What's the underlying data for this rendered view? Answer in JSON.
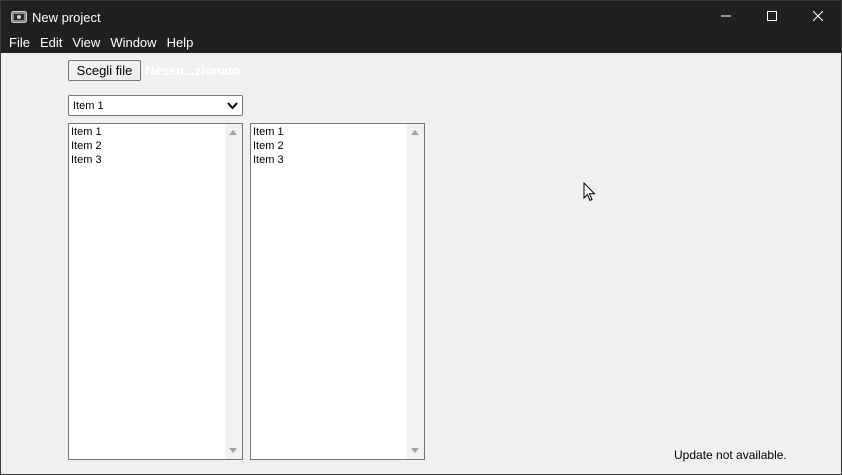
{
  "window": {
    "title": "New project",
    "icon": "app-logo-icon",
    "controls": [
      "minimize-icon",
      "maximize-icon",
      "close-icon"
    ]
  },
  "menubar": {
    "items": [
      {
        "label": "File"
      },
      {
        "label": "Edit"
      },
      {
        "label": "View"
      },
      {
        "label": "Window"
      },
      {
        "label": "Help"
      }
    ]
  },
  "file_input": {
    "button_label": "Scegli file",
    "status_text": "Nessu...zionato"
  },
  "dropdown": {
    "selected": "Item 1"
  },
  "listbox_1": {
    "items": [
      "Item 1",
      "Item 2",
      "Item 3"
    ]
  },
  "listbox_2": {
    "items": [
      "Item 1",
      "Item 2",
      "Item 3"
    ]
  },
  "status": {
    "update_text": "Update not available."
  },
  "colors": {
    "titlebar_bg": "#202020",
    "content_bg": "#f0f0f0",
    "border": "#767676"
  }
}
